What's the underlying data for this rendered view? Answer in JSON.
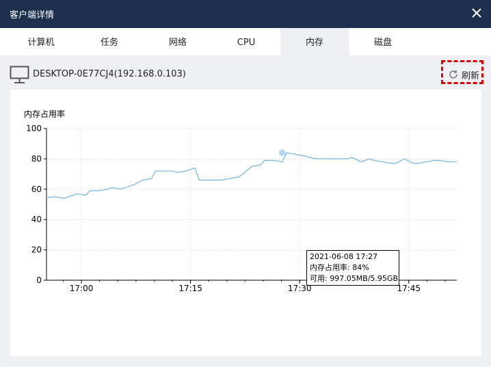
{
  "window": {
    "title": "客户端详情"
  },
  "tabs": [
    {
      "label": "计算机",
      "active": false
    },
    {
      "label": "任务",
      "active": false
    },
    {
      "label": "网络",
      "active": false
    },
    {
      "label": "CPU",
      "active": false
    },
    {
      "label": "内存",
      "active": true
    },
    {
      "label": "磁盘",
      "active": false
    }
  ],
  "host": {
    "name": "DESKTOP-0E77CJ4(192.168.0.103)"
  },
  "toolbar": {
    "refresh_label": "刷新"
  },
  "colors": {
    "titlebar": "#1e2f4e",
    "line": "#6eb4e6",
    "highlight": "#e00000",
    "hover_point": "#b8d8f4"
  },
  "tooltip": {
    "time": "2021-06-08 17:27",
    "usage": "内存占用率: 84%",
    "available": "可用: 997.05MB/5.95GB"
  },
  "chart_data": {
    "type": "line",
    "ylabel": "内存占用率",
    "ylim": [
      0,
      100
    ],
    "yticks": [
      "0",
      "20",
      "40",
      "60",
      "80",
      "100"
    ],
    "xticks": [
      "17:00",
      "17:15",
      "17:30",
      "17:45"
    ],
    "xlim": [
      16.92,
      17.86
    ],
    "grid": true,
    "series": [
      {
        "x": [
          16.92,
          16.94,
          16.96,
          16.97,
          16.99,
          17.01,
          17.02,
          17.04,
          17.06,
          17.07,
          17.09,
          17.11,
          17.12,
          17.14,
          17.16,
          17.17,
          17.19,
          17.21,
          17.22,
          17.24,
          17.26,
          17.27,
          17.29,
          17.31,
          17.32,
          17.34,
          17.36,
          17.37,
          17.39,
          17.41,
          17.42,
          17.44,
          17.46,
          17.47,
          17.49,
          17.51,
          17.52,
          17.54,
          17.56,
          17.57,
          17.59,
          17.61,
          17.62,
          17.64,
          17.66,
          17.67,
          17.69,
          17.71,
          17.72,
          17.74,
          17.76,
          17.77,
          17.79,
          17.81,
          17.82,
          17.84,
          17.86
        ],
        "values": [
          54.5,
          55,
          54,
          55,
          57,
          56,
          59,
          59,
          60,
          61,
          60,
          62,
          63,
          66,
          67,
          72,
          72,
          72,
          71,
          72,
          74,
          66,
          66,
          66,
          66,
          67,
          68,
          70,
          75,
          76,
          79,
          79,
          78,
          84,
          83,
          82,
          81,
          80,
          80,
          80,
          80,
          80,
          81,
          78,
          80,
          79,
          78,
          77,
          77,
          80,
          77,
          77,
          78,
          79,
          79,
          78,
          78
        ]
      }
    ],
    "hover": {
      "x": 17.46,
      "y": 84
    }
  }
}
